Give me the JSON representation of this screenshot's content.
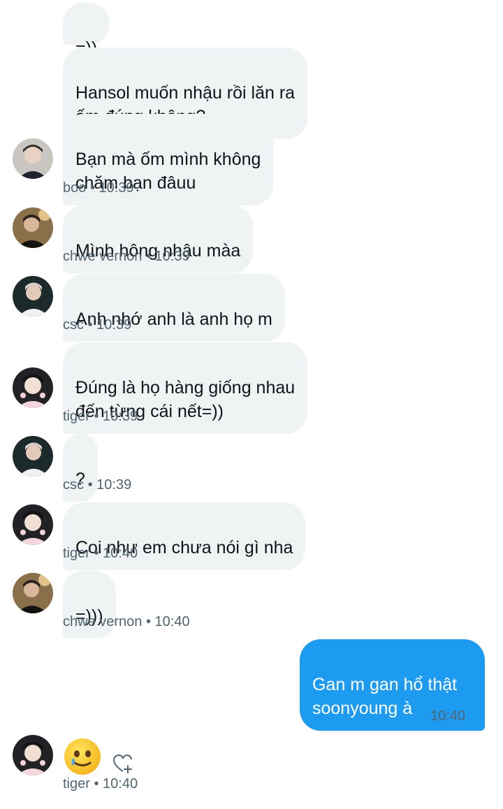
{
  "messages": [
    {
      "text": "=))"
    },
    {
      "text": "Hansol muốn nhậu rồi lăn ra\nốm đúng không?"
    },
    {
      "text": "Bạn mà ốm mình không\nchăm bạn đâuu",
      "sender": "boo",
      "time": "10:39"
    },
    {
      "text": "Mình hông nhậu màa",
      "sender": "chwe vernon",
      "time": "10:39"
    },
    {
      "text": "Anh nhớ anh là anh họ m",
      "sender": "csc",
      "time": "10:39"
    },
    {
      "text": "Đúng là họ hàng giống nhau\nđến từng cái nết=))",
      "sender": "tiger",
      "time": "10:39"
    },
    {
      "text": "?",
      "sender": "csc",
      "time": "10:39"
    },
    {
      "text": "Coi như em chưa nói gì nha",
      "sender": "tiger",
      "time": "10:40"
    },
    {
      "text": "=)))",
      "sender": "chwe vernon",
      "time": "10:40"
    }
  ],
  "my_message": {
    "text": "Gan m gan hổ thật\nsoonyoung à",
    "time": "10:40",
    "status_icon": "sent-check-icon"
  },
  "last": {
    "emoji": "face-holding-back-tears",
    "sender": "tiger",
    "time": "10:40",
    "react_icon": "heart-plus-icon"
  },
  "meta_sep": "•",
  "colors": {
    "bubble_other": "#eff3f4",
    "bubble_mine": "#1d9bf0",
    "meta_text": "#536471",
    "check": "#1d9bf0"
  }
}
